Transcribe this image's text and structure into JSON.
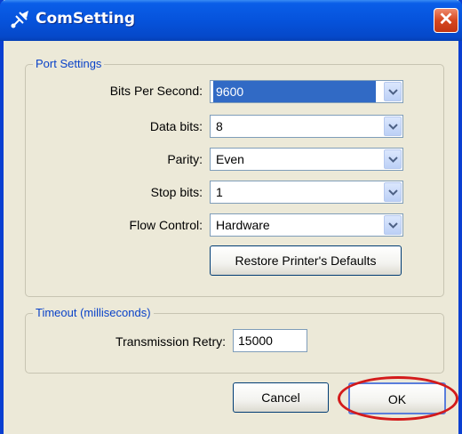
{
  "window": {
    "title": "ComSetting",
    "title_icon": "satellite-icon",
    "close_glyph": "✕"
  },
  "port_settings": {
    "legend": "Port Settings",
    "bits_per_second": {
      "label": "Bits Per Second:",
      "value": "9600"
    },
    "data_bits": {
      "label": "Data bits:",
      "value": "8"
    },
    "parity": {
      "label": "Parity:",
      "value": "Even"
    },
    "stop_bits": {
      "label": "Stop bits:",
      "value": "1"
    },
    "flow_control": {
      "label": "Flow Control:",
      "value": "Hardware"
    },
    "restore_button": "Restore Printer's Defaults"
  },
  "timeout": {
    "legend": "Timeout (milliseconds)",
    "transmission_retry": {
      "label": "Transmission Retry:",
      "value": "15000"
    }
  },
  "buttons": {
    "cancel": "Cancel",
    "ok": "OK"
  },
  "colors": {
    "title_bar": "#0653dc",
    "dialog_bg": "#ece9d8",
    "selection": "#316ac5",
    "highlight_ring": "#d31b1b"
  }
}
